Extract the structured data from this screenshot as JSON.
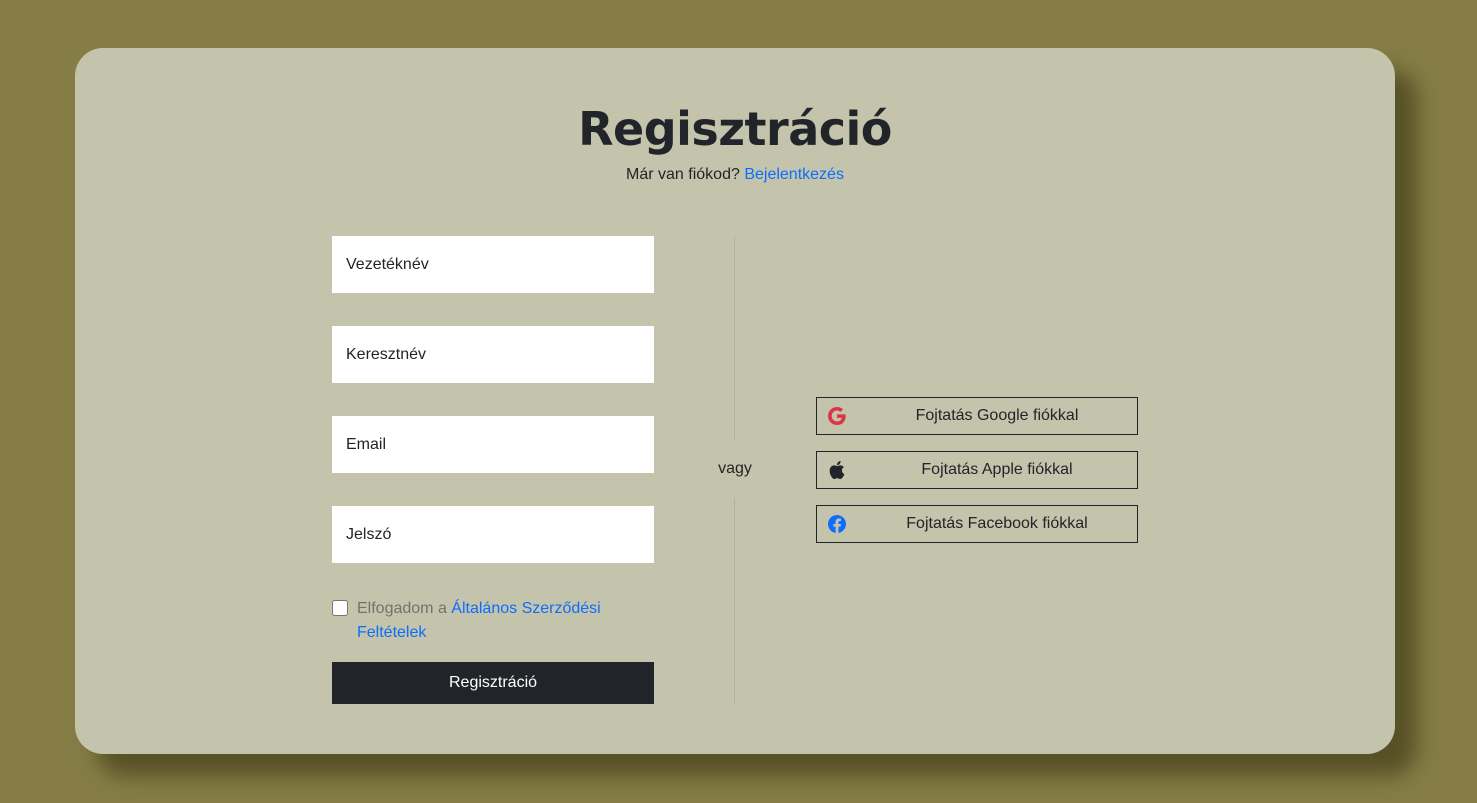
{
  "header": {
    "title": "Regisztráció",
    "login_prompt": "Már van fiókod?",
    "login_link": "Bejelentkezés"
  },
  "form": {
    "last_name_placeholder": "Vezetéknév",
    "first_name_placeholder": "Keresztnév",
    "email_placeholder": "Email",
    "password_placeholder": "Jelszó",
    "terms_prefix": "Elfogadom a",
    "terms_link": "Általános Szerződési Feltételek",
    "terms_checked": false,
    "submit_label": "Regisztráció"
  },
  "divider": {
    "label": "vagy"
  },
  "social": [
    {
      "label": "Fojtatás Google fiókkal",
      "icon": "google-icon",
      "icon_color": "#dc3545"
    },
    {
      "label": "Fojtatás Apple fiókkal",
      "icon": "apple-icon",
      "icon_color": "#212529"
    },
    {
      "label": "Fojtatás Facebook fiókkal",
      "icon": "facebook-icon",
      "icon_color": "#0d6efd"
    }
  ],
  "colors": {
    "page_background": "#857d45",
    "card_background": "#c4c3ab",
    "primary_dark": "#212529",
    "link": "#0d6efd"
  }
}
